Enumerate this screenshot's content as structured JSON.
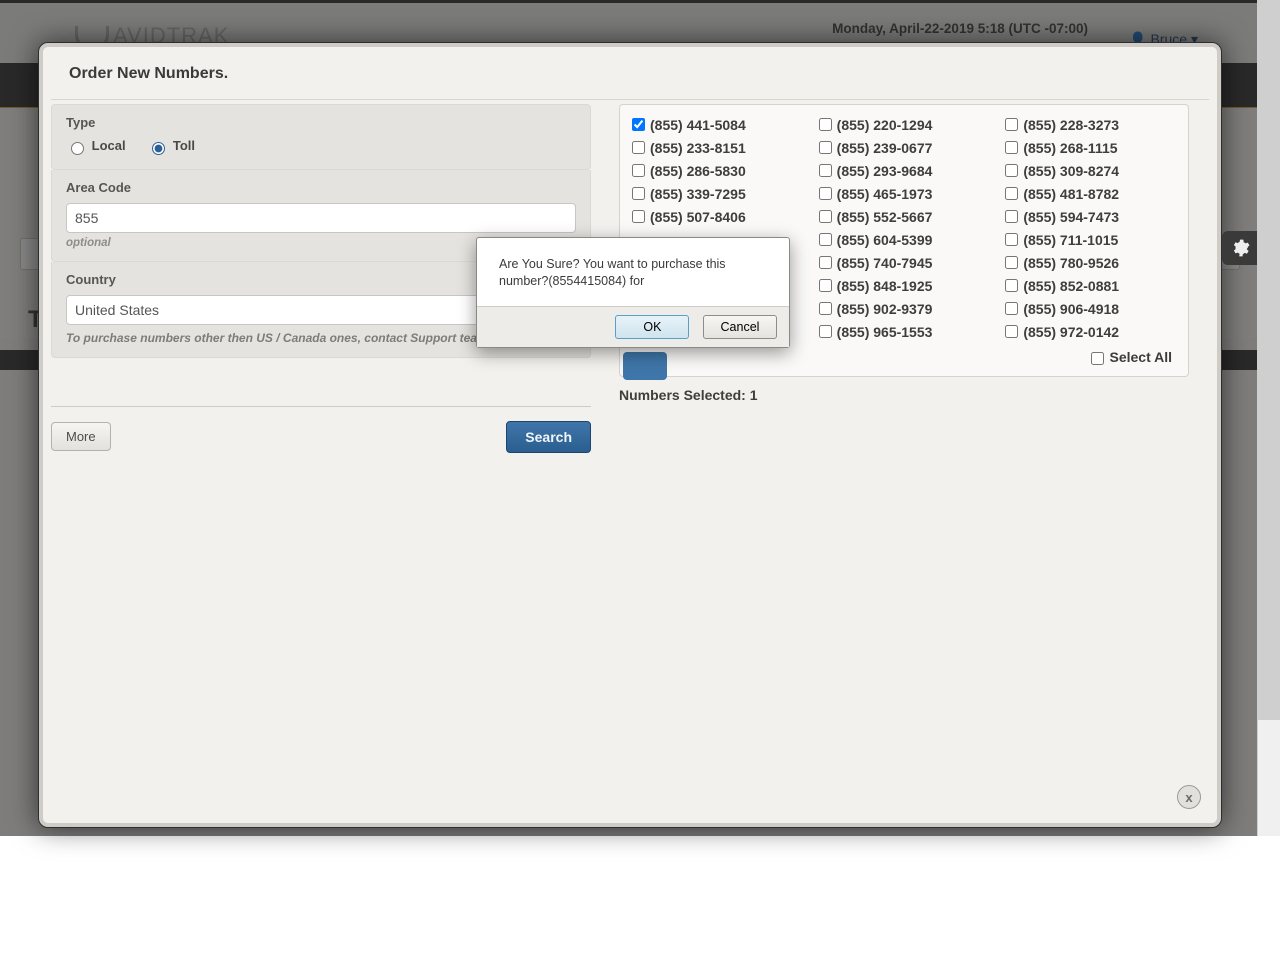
{
  "header": {
    "brand": "AVIDTRAK",
    "datetime": "Monday, April-22-2019 5:18 (UTC -07:00)",
    "user": "Bruce"
  },
  "modal": {
    "title": "Order New Numbers.",
    "left": {
      "type_label": "Type",
      "radio_local": "Local",
      "radio_toll": "Toll",
      "area_code_label": "Area Code",
      "area_code_value": "855",
      "area_code_hint": "optional",
      "country_label": "Country",
      "country_value": "United States",
      "country_hint": "To purchase numbers other then US / Canada ones, contact Support tea",
      "more_btn": "More",
      "search_btn": "Search"
    },
    "right": {
      "col1": [
        "(855) 441-5084",
        "(855) 233-8151",
        "(855) 286-5830",
        "(855) 339-7295",
        "(855) 507-8406"
      ],
      "col2": [
        "(855) 220-1294",
        "(855) 239-0677",
        "(855) 293-9684",
        "(855) 465-1973",
        "(855) 552-5667",
        "(855) 604-5399",
        "(855) 740-7945",
        "(855) 848-1925",
        "(855) 902-9379",
        "(855) 965-1553"
      ],
      "col3": [
        "(855) 228-3273",
        "(855) 268-1115",
        "(855) 309-8274",
        "(855) 481-8782",
        "(855) 594-7473",
        "(855) 711-1015",
        "(855) 780-9526",
        "(855) 852-0881",
        "(855) 906-4918",
        "(855) 972-0142"
      ],
      "select_all": "Select All",
      "selected_label": "Numbers Selected: 1"
    },
    "close_label": "x"
  },
  "confirm": {
    "message": "Are You Sure? You want to purchase this number?(8554415084) for",
    "ok": "OK",
    "cancel": "Cancel"
  },
  "ghost_label": "T"
}
